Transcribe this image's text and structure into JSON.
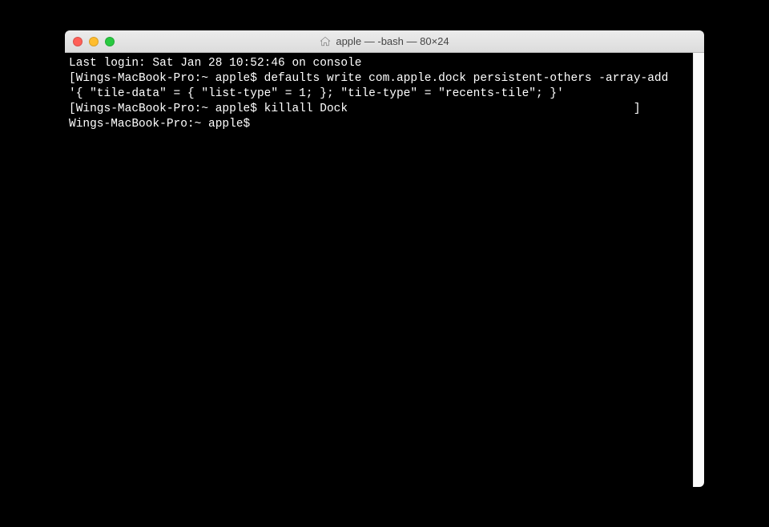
{
  "window": {
    "title": "apple — -bash — 80×24"
  },
  "terminal": {
    "lines": [
      "Last login: Sat Jan 28 10:52:46 on console",
      "[Wings-MacBook-Pro:~ apple$ defaults write com.apple.dock persistent-others -array-add '{ \"tile-data\" = { \"list-type\" = 1; }; \"tile-type\" = \"recents-tile\"; }'",
      "[Wings-MacBook-Pro:~ apple$ killall Dock                                         ]",
      "Wings-MacBook-Pro:~ apple$ "
    ]
  }
}
